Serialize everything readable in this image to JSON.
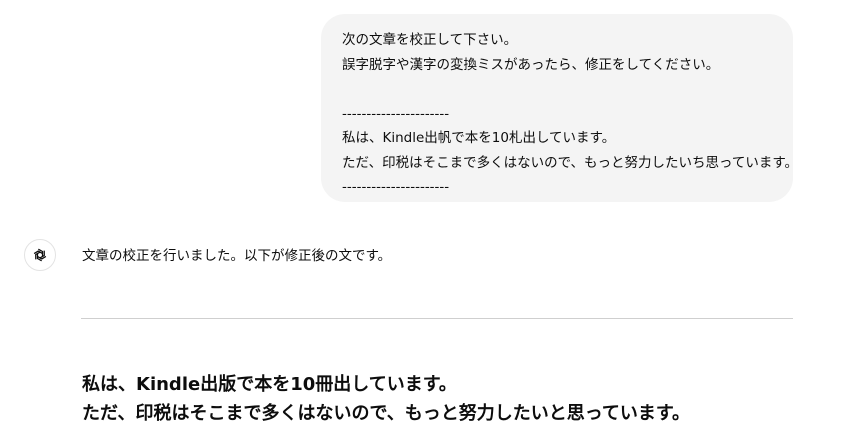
{
  "user_message": {
    "lines": [
      "次の文章を校正して下さい。",
      "誤字脱字や漢字の変換ミスがあったら、修正をしてください。",
      "",
      "----------------------",
      "私は、Kindle出帆で本を10札出しています。",
      "ただ、印税はそこまで多くはないので、もっと努力したいち思っています。",
      "----------------------"
    ]
  },
  "assistant": {
    "avatar_icon": "openai-logo-icon",
    "intro": "文章の校正を行いました。以下が修正後の文です。",
    "corrected_lines": [
      "私は、Kindle出版で本を10冊出しています。",
      "ただ、印税はそこまで多くはないので、もっと努力したいと思っています。"
    ]
  }
}
